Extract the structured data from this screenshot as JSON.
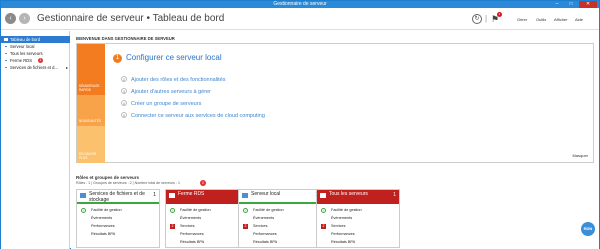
{
  "window": {
    "title": "Gestionnaire de serveur"
  },
  "header": {
    "title": "Gestionnaire de serveur • Tableau de bord",
    "notification_count": "1",
    "menus": [
      "Gérer",
      "Outils",
      "Afficher",
      "Aide"
    ]
  },
  "sidebar": {
    "items": [
      {
        "label": "Tableau de bord",
        "active": true
      },
      {
        "label": "Serveur local"
      },
      {
        "label": "Tous les serveurs"
      },
      {
        "label": "Ferme RDS",
        "badge": "1"
      },
      {
        "label": "Services de fichiers et d..."
      }
    ]
  },
  "welcome": {
    "title": "BIENVENUE DANS GESTIONNAIRE DE SERVEUR",
    "tiles": [
      "DÉMARRAGE RAPIDE",
      "NOUVEAUTÉS",
      "EN SAVOIR PLUS"
    ],
    "tasks": [
      {
        "num": "1",
        "label": "Configurer ce serveur local"
      },
      {
        "num": "2",
        "label": "Ajouter des rôles et des fonctionnalités"
      },
      {
        "num": "3",
        "label": "Ajouter d'autres serveurs à gérer"
      },
      {
        "num": "4",
        "label": "Créer un groupe de serveurs"
      },
      {
        "num": "5",
        "label": "Connecter ce serveur aux services de cloud computing"
      }
    ],
    "hide_label": "Masquer"
  },
  "groups": {
    "title": "Rôles et groupes de serveurs",
    "subtitle": "Rôles : 1  |  Groupes de serveurs : 2  |  Nombre total de serveurs : 1",
    "badge": "2",
    "cards": [
      {
        "name": "Services de fichiers et de stockage",
        "count": "1",
        "style": "green",
        "rows": [
          {
            "label": "Facilité de gestion",
            "status": "ok"
          },
          {
            "label": "Événements"
          },
          {
            "label": "Performances"
          },
          {
            "label": "Résultats BPA"
          }
        ]
      },
      {
        "name": "Ferme RDS",
        "count": "1",
        "style": "red",
        "rows": [
          {
            "label": "Facilité de gestion",
            "status": "ok"
          },
          {
            "label": "Événements"
          },
          {
            "label": "Services",
            "status": "err",
            "num": "2"
          },
          {
            "label": "Performances"
          },
          {
            "label": "Résultats BPA"
          }
        ]
      },
      {
        "name": "Serveur local",
        "count": "1",
        "style": "green",
        "rows": [
          {
            "label": "Facilité de gestion",
            "status": "ok"
          },
          {
            "label": "Événements"
          },
          {
            "label": "Services",
            "status": "err",
            "num": "2"
          },
          {
            "label": "Performances"
          },
          {
            "label": "Résultats BPA"
          }
        ]
      },
      {
        "name": "Tous les serveurs",
        "count": "1",
        "style": "red",
        "rows": [
          {
            "label": "Facilité de gestion",
            "status": "ok"
          },
          {
            "label": "Événements"
          },
          {
            "label": "Services",
            "status": "err",
            "num": "2"
          },
          {
            "label": "Performances"
          },
          {
            "label": "Résultats BPA"
          }
        ]
      }
    ]
  },
  "corner_badge": "RDN",
  "colors": {
    "accent": "#2b8ad7",
    "orange": "#f47c20",
    "red": "#c0201e",
    "green": "#3aa83a"
  }
}
